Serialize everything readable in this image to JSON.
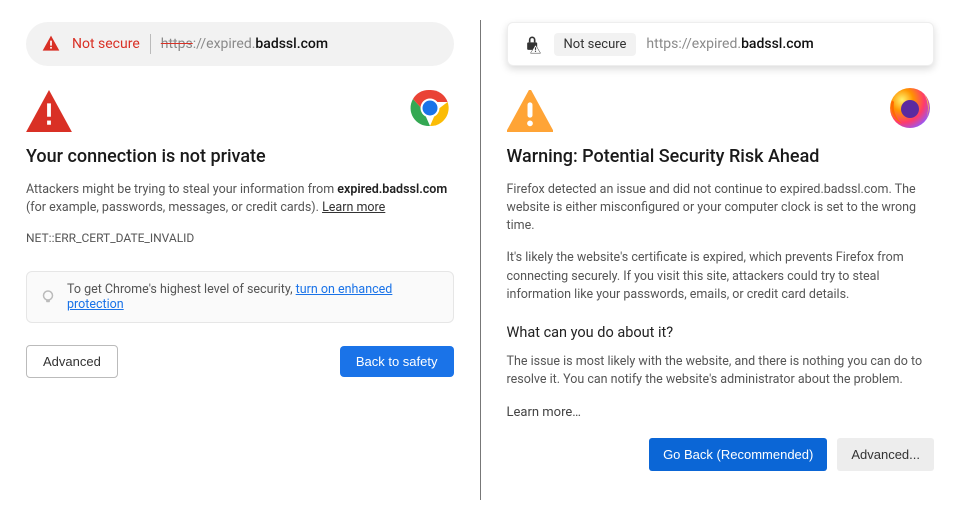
{
  "chrome": {
    "urlbar": {
      "not_secure_label": "Not secure",
      "url_scheme_struck": "https",
      "url_after_scheme": "://expired.",
      "url_bold": "badssl.com"
    },
    "title": "Your connection is not private",
    "body_prefix": "Attackers might be trying to steal your information from ",
    "body_bold_domain": "expired.badssl.com",
    "body_suffix": " (for example, passwords, messages, or credit cards). ",
    "learn_more": "Learn more",
    "error_code": "NET::ERR_CERT_DATE_INVALID",
    "tip_prefix": "To get Chrome's highest level of security, ",
    "tip_link": "turn on enhanced protection",
    "btn_advanced": "Advanced",
    "btn_safety": "Back to safety"
  },
  "firefox": {
    "urlbar": {
      "not_secure_label": "Not secure",
      "url_prefix": "https://expired.",
      "url_bold": "badssl.com"
    },
    "title": "Warning: Potential Security Risk Ahead",
    "para1": "Firefox detected an issue and did not continue to expired.badssl.com. The website is either misconfigured or your computer clock is set to the wrong time.",
    "para2": "It's likely the website's certificate is expired, which prevents Firefox from connecting securely. If you visit this site, attackers could try to steal information like your passwords, emails, or credit card details.",
    "subhead": "What can you do about it?",
    "para3": "The issue is most likely with the website, and there is nothing you can do to resolve it. You can notify the website's administrator about the problem.",
    "learn_more": "Learn more…",
    "btn_goback": "Go Back (Recommended)",
    "btn_advanced": "Advanced..."
  }
}
